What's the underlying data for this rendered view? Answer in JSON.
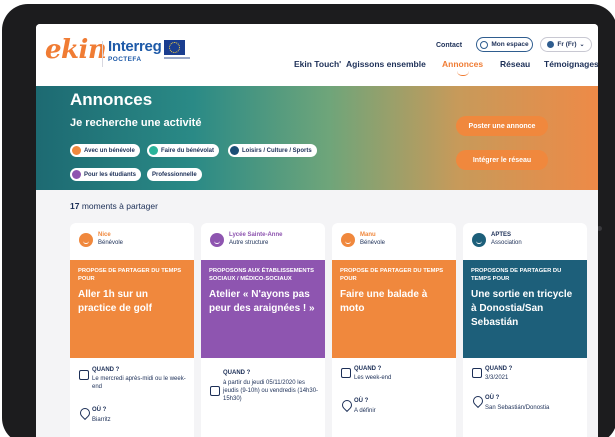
{
  "header": {
    "logo_ekin": "ekin",
    "logo_interreg": "Interreg",
    "logo_poctefa": "POCTEFA",
    "top_links": {
      "contact": "Contact",
      "mon_espace": "Mon espace",
      "lang": "Fr (Fr)"
    },
    "nav": [
      "Ekin Touch'",
      "Agissons ensemble",
      "Annonces",
      "Réseau",
      "Témoignages"
    ],
    "active_nav": "Annonces"
  },
  "hero": {
    "title": "Annonces",
    "subtitle": "Je recherche une activité",
    "filters": [
      {
        "label": "Avec un bénévole",
        "color": "#f0883d"
      },
      {
        "label": "Faire du bénévolat",
        "color": "#2bb39a"
      },
      {
        "label": "Loisirs / Culture / Sports",
        "color": "#1c4f76"
      },
      {
        "label": "Pour les étudiants",
        "color": "#8e55b0"
      },
      {
        "label": "Professionnelle",
        "color": ""
      }
    ],
    "btn_post": "Poster une annonce",
    "btn_join": "Intégrer le réseau"
  },
  "results": {
    "count": "17",
    "text": "moments à partager"
  },
  "cards": [
    {
      "name": "Nice",
      "role": "Bénévole",
      "kicker": "PROPOSE DE PARTAGER DU TEMPS POUR",
      "title": "Aller 1h sur un practice de golf",
      "when_label": "QUAND ?",
      "when": "Le mercredi après-midi ou le week-end",
      "where_label": "OÙ ?",
      "where": "Biarritz",
      "color": "#f0883d",
      "name_color": "#f0883d"
    },
    {
      "name": "Lycée Sainte-Anne",
      "role": "Autre structure",
      "kicker": "PROPOSONS AUX ÉTABLISSEMENTS SOCIAUX / MÉDICO-SOCIAUX",
      "title": "Atelier « N'ayons pas peur des araignées ! »",
      "when_label": "QUAND ?",
      "when": "à partir du jeudi 05/11/2020 les jeudis (9-10h) ou vendredis (14h30-15h30)",
      "where_label": "",
      "where": "",
      "color": "#8e55b0",
      "name_color": "#8e55b0"
    },
    {
      "name": "Manu",
      "role": "Bénévole",
      "kicker": "PROPOSE DE PARTAGER DU TEMPS POUR",
      "title": "Faire une balade à moto",
      "when_label": "QUAND ?",
      "when": "Les week-end",
      "where_label": "OÙ ?",
      "where": "A définir",
      "color": "#f0883d",
      "name_color": "#f0883d"
    },
    {
      "name": "APTES",
      "role": "Association",
      "kicker": "PROPOSONS DE PARTAGER DU TEMPS POUR",
      "title": "Une sortie en tricycle à Donostia/San Sebastián",
      "when_label": "QUAND ?",
      "when": "3/3/2021",
      "where_label": "OÙ ?",
      "where": "San Sebastián/Donostia",
      "color": "#1d5f7a",
      "name_color": "#1c2f57"
    }
  ]
}
